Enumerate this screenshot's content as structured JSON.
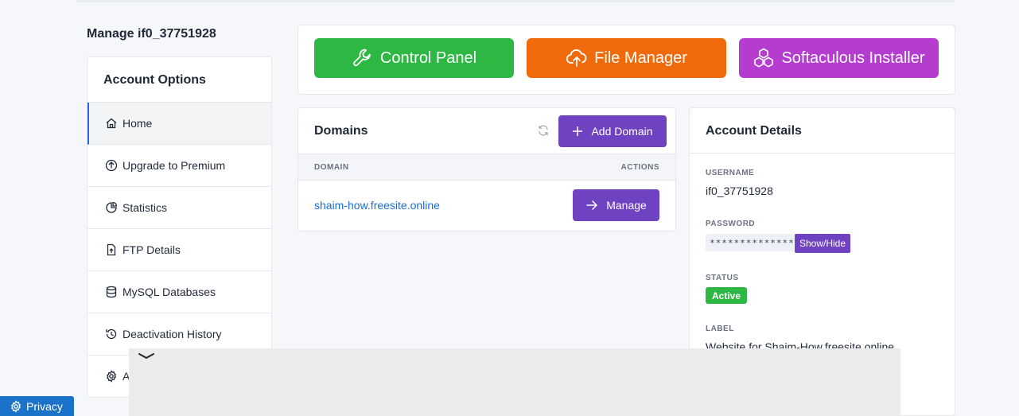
{
  "page": {
    "heading": "Manage if0_37751928"
  },
  "sidebar": {
    "title": "Account Options",
    "items": [
      {
        "label": "Home",
        "icon": "home-icon"
      },
      {
        "label": "Upgrade to Premium",
        "icon": "arrow-up-circle-icon"
      },
      {
        "label": "Statistics",
        "icon": "pie-chart-icon"
      },
      {
        "label": "FTP Details",
        "icon": "file-upload-icon"
      },
      {
        "label": "MySQL Databases",
        "icon": "database-icon"
      },
      {
        "label": "Deactivation History",
        "icon": "history-icon"
      },
      {
        "label": "A",
        "icon": "gear-icon"
      }
    ]
  },
  "quick_actions": {
    "control_panel": "Control Panel",
    "file_manager": "File Manager",
    "softaculous": "Softaculous Installer"
  },
  "domains": {
    "title": "Domains",
    "add_label": "Add Domain",
    "columns": [
      "DOMAIN",
      "ACTIONS"
    ],
    "rows": [
      {
        "domain": "shaim-how.freesite.online",
        "action": "Manage"
      }
    ]
  },
  "account": {
    "title": "Account Details",
    "username_label": "USERNAME",
    "username": "if0_37751928",
    "password_label": "PASSWORD",
    "password_mask": "**************",
    "password_toggle": "Show/Hide",
    "status_label": "STATUS",
    "status": "Active",
    "label_label": "LABEL",
    "label": "Website for Shaim-How.freesite.online"
  },
  "footer": {
    "privacy": "Privacy"
  },
  "colors": {
    "green": "#2cb843",
    "orange": "#f06a0c",
    "magenta": "#b43ccf",
    "purple": "#6f42c1",
    "link": "#1a6fd4"
  }
}
